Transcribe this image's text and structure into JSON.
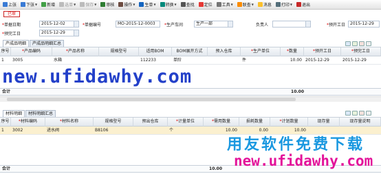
{
  "toolbar": {
    "items": [
      {
        "label": "上张",
        "has_menu": false,
        "disabled": false,
        "icon": "prev-icon",
        "color": "#3a7bd5"
      },
      {
        "label": "下张",
        "has_menu": true,
        "disabled": false,
        "icon": "next-icon",
        "color": "#3a7bd5"
      },
      {
        "label": "新增",
        "has_menu": false,
        "disabled": false,
        "icon": "add-icon",
        "color": "#43a047"
      },
      {
        "label": "选单",
        "has_menu": true,
        "disabled": true,
        "icon": "select-icon",
        "color": "#bbbbbb"
      },
      {
        "label": "保存",
        "has_menu": true,
        "disabled": true,
        "icon": "save-icon",
        "color": "#bbbbbb"
      },
      {
        "label": "审核",
        "has_menu": false,
        "disabled": false,
        "icon": "approve-icon",
        "color": "#2e7d32"
      },
      {
        "label": "操作",
        "has_menu": true,
        "disabled": false,
        "icon": "operate-icon",
        "color": "#6d4c41"
      },
      {
        "label": "生单",
        "has_menu": true,
        "disabled": false,
        "icon": "generate-icon",
        "color": "#1565c0"
      },
      {
        "label": "转换",
        "has_menu": true,
        "disabled": false,
        "icon": "convert-icon",
        "color": "#00897b"
      },
      {
        "label": "查找",
        "has_menu": false,
        "disabled": false,
        "icon": "find-icon",
        "color": "#555555"
      },
      {
        "label": "定位",
        "has_menu": false,
        "disabled": false,
        "icon": "locate-icon",
        "color": "#e53935"
      },
      {
        "label": "工具",
        "has_menu": true,
        "disabled": false,
        "icon": "tools-icon",
        "color": "#757575"
      },
      {
        "label": "联查",
        "has_menu": true,
        "disabled": false,
        "icon": "link-icon",
        "color": "#fb8c00"
      },
      {
        "label": "消息",
        "has_menu": false,
        "disabled": false,
        "icon": "message-icon",
        "color": "#fbc02d"
      },
      {
        "label": "打印",
        "has_menu": true,
        "disabled": false,
        "icon": "print-icon",
        "color": "#546e7a"
      },
      {
        "label": "退出",
        "has_menu": false,
        "disabled": false,
        "icon": "exit-icon",
        "color": "#c62828"
      }
    ]
  },
  "status_badge": "已审",
  "header": {
    "doc_date_label": "单据日期",
    "doc_date": "2015-12-02",
    "doc_no_label": "单据编号",
    "doc_no": "MO-2015-12-0003",
    "workshop_label": "生产车间",
    "workshop": "生产一部",
    "person_label": "负责人",
    "person": "",
    "start_date_label": "预开工日",
    "start_date": "2015-12-29",
    "finish_date_label": "预完工日",
    "finish_date": "2015-12-29"
  },
  "product_section": {
    "tabs": [
      "产成品明细",
      "产成品明细汇总"
    ],
    "columns": [
      "序号",
      "产品编码",
      "产品名称",
      "规格型号",
      "适用BOM",
      "BOM展开方式",
      "预入仓库",
      "生产单位",
      "数量",
      "预开工日",
      "预完工日"
    ],
    "required_columns": [
      1,
      2,
      7,
      8,
      9,
      10
    ],
    "rows": [
      {
        "seq": "1",
        "code": "3005",
        "name": "水箱",
        "spec": "",
        "bom": "112233",
        "bom_mode": "单阶",
        "warehouse": "",
        "unit": "件",
        "qty": "10.00",
        "start": "2015-12-29",
        "finish": "2015-12-29"
      }
    ],
    "total_label": "合计",
    "total_qty": "10.00"
  },
  "material_section": {
    "tabs": [
      "材料明细",
      "材料明细汇总"
    ],
    "columns": [
      "序号",
      "材料编码",
      "材料名称",
      "规格型号",
      "预出仓库",
      "计量单位",
      "需用数量",
      "损耗数量",
      "计划数量",
      "现存量",
      "现存量说明"
    ],
    "required_columns": [
      1,
      2,
      5,
      6,
      8
    ],
    "rows": [
      {
        "seq": "1",
        "code": "3002",
        "name": "进水阀",
        "spec": "B8106",
        "warehouse": "",
        "unit": "个",
        "need_qty": "10.00",
        "loss_qty": "0.00",
        "plan_qty": "10.00",
        "stock": "",
        "stock_note": ""
      }
    ],
    "total_label": "合计",
    "total_qty": "10.00"
  },
  "watermarks": {
    "url_top": "new.ufidawhy.com",
    "slogan": "用友软件免费下载",
    "url_bottom": "new.ufidawhy.com"
  }
}
